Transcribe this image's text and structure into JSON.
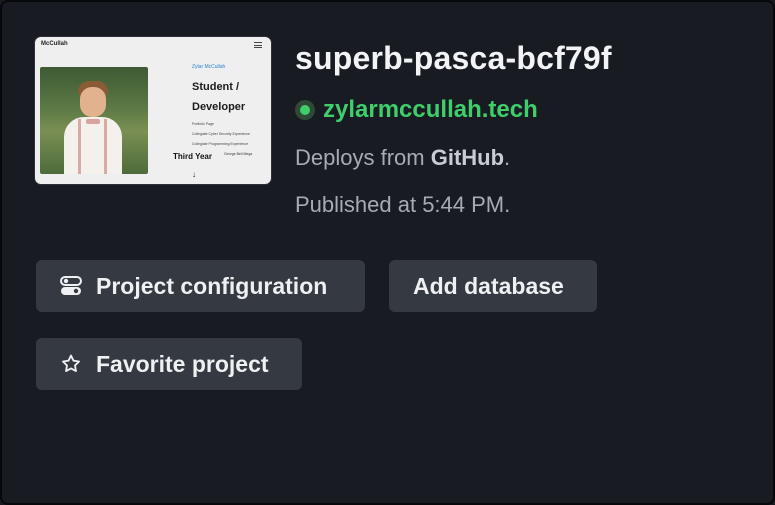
{
  "thumbnail": {
    "brand": "McCullah",
    "name": "Zylar McCullah",
    "role": "Student / Developer",
    "links": [
      "Portfolio Page",
      "Collegiate Cyber Security Experience",
      "Collegiate Programming Experience"
    ],
    "year": "Third Year",
    "year_sub": "George Bell Mega"
  },
  "site": {
    "name": "superb-pasca-bcf79f",
    "domain": "zylarmccullah.tech",
    "status_color": "#3ecf6b",
    "deploys_prefix": "Deploys from ",
    "deploys_source": "GitHub",
    "deploys_suffix": ".",
    "published": "Published at 5:44 PM."
  },
  "actions": {
    "config_label": "Project configuration",
    "config_icon": "toggle-settings-icon",
    "database_label": "Add database",
    "favorite_label": "Favorite project",
    "favorite_icon": "star-icon"
  }
}
